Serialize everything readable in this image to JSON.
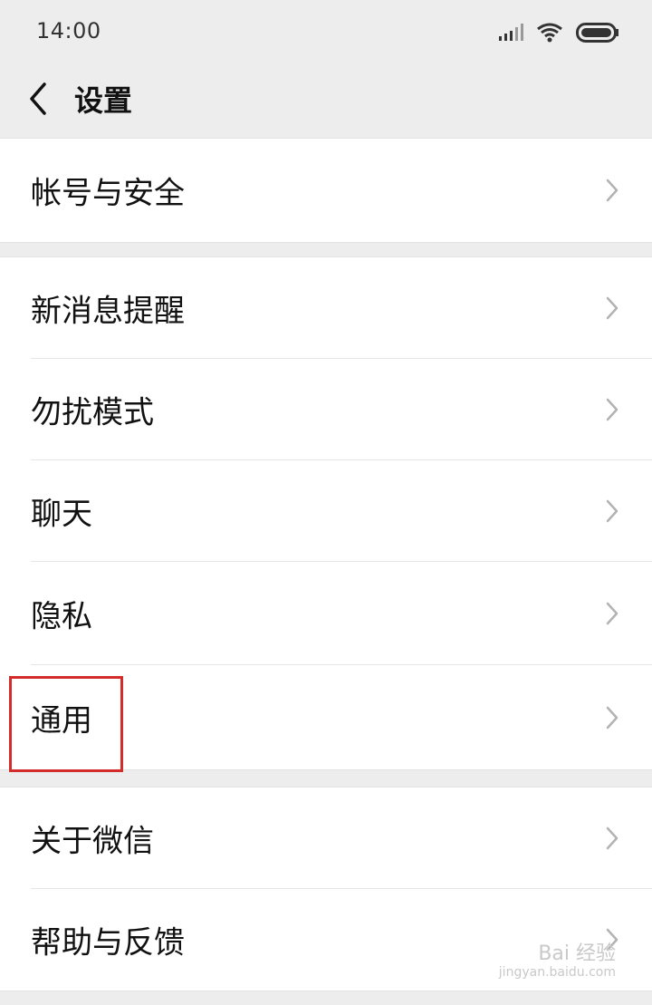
{
  "status_bar": {
    "time": "14:00",
    "icons": [
      "signal-icon",
      "wifi-icon",
      "battery-icon"
    ]
  },
  "nav": {
    "back_icon": "chevron-left-icon",
    "title": "设置"
  },
  "groups": [
    {
      "items": [
        {
          "label": "帐号与安全"
        }
      ]
    },
    {
      "items": [
        {
          "label": "新消息提醒"
        },
        {
          "label": "勿扰模式"
        },
        {
          "label": "聊天"
        },
        {
          "label": "隐私"
        },
        {
          "label": "通用"
        }
      ]
    },
    {
      "items": [
        {
          "label": "关于微信"
        },
        {
          "label": "帮助与反馈"
        }
      ]
    }
  ],
  "annotation": {
    "highlight_color": "#d42b2b",
    "target": "通用"
  },
  "watermark": {
    "brand": "Bai 经验",
    "url": "jingyan.baidu.com"
  }
}
